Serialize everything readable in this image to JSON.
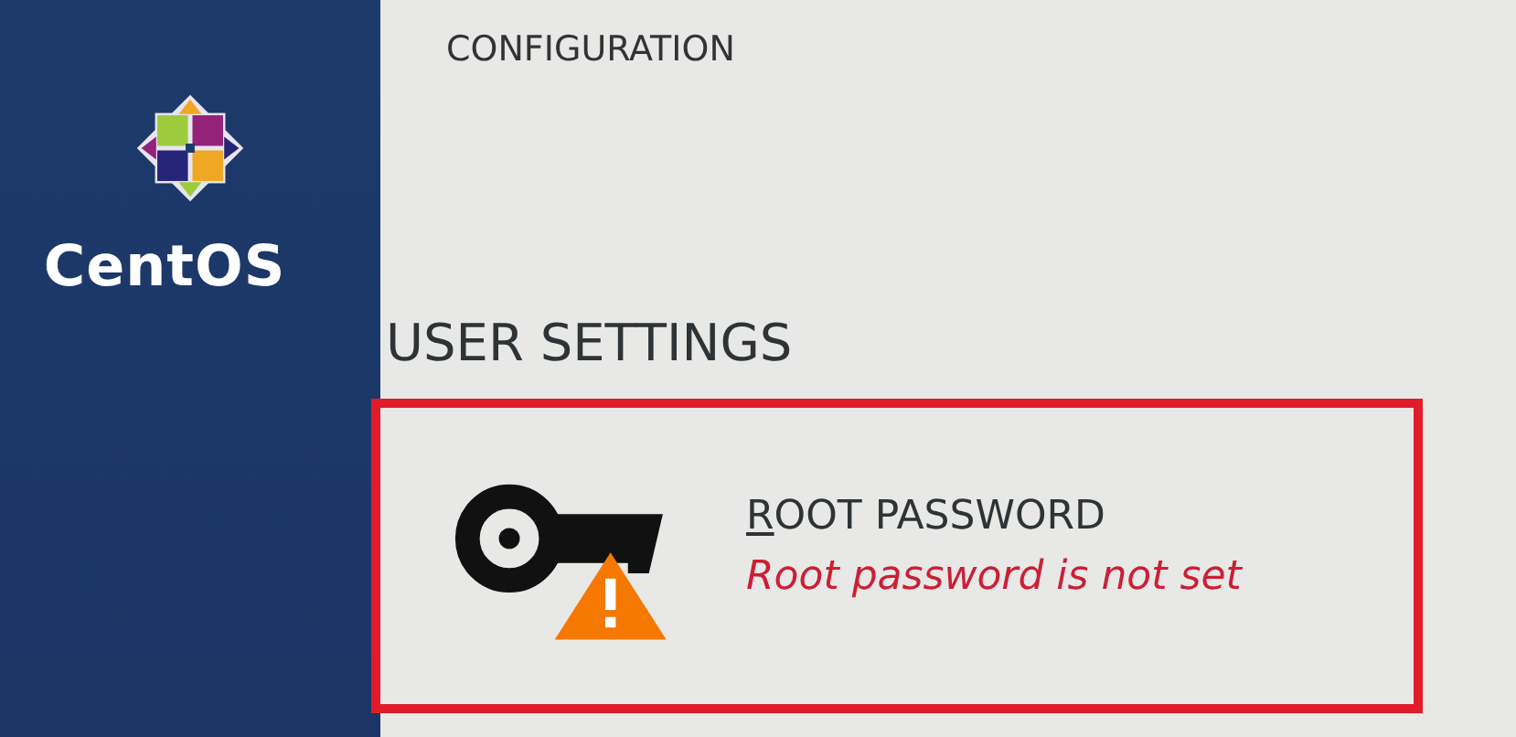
{
  "sidebar": {
    "brand": "CentOS"
  },
  "sections": [
    {
      "title": "CONFIGURATION"
    },
    {
      "title": "USER SETTINGS",
      "spokes": [
        {
          "kind": "password",
          "title": "ROOT PASSWORD",
          "status": "Root password is not set",
          "warning": true,
          "highlighted": true
        }
      ]
    }
  ]
}
